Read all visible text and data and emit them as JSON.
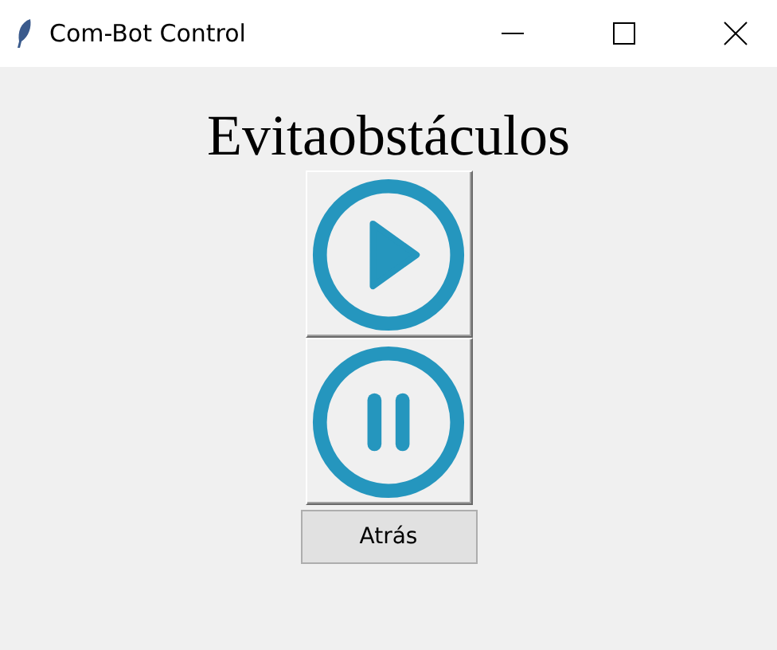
{
  "window": {
    "title": "Com-Bot Control"
  },
  "heading": "Evitaobstáculos",
  "icon_buttons": [
    {
      "kind": "play"
    },
    {
      "kind": "pause"
    }
  ],
  "back_button": {
    "label": "Atrás"
  }
}
